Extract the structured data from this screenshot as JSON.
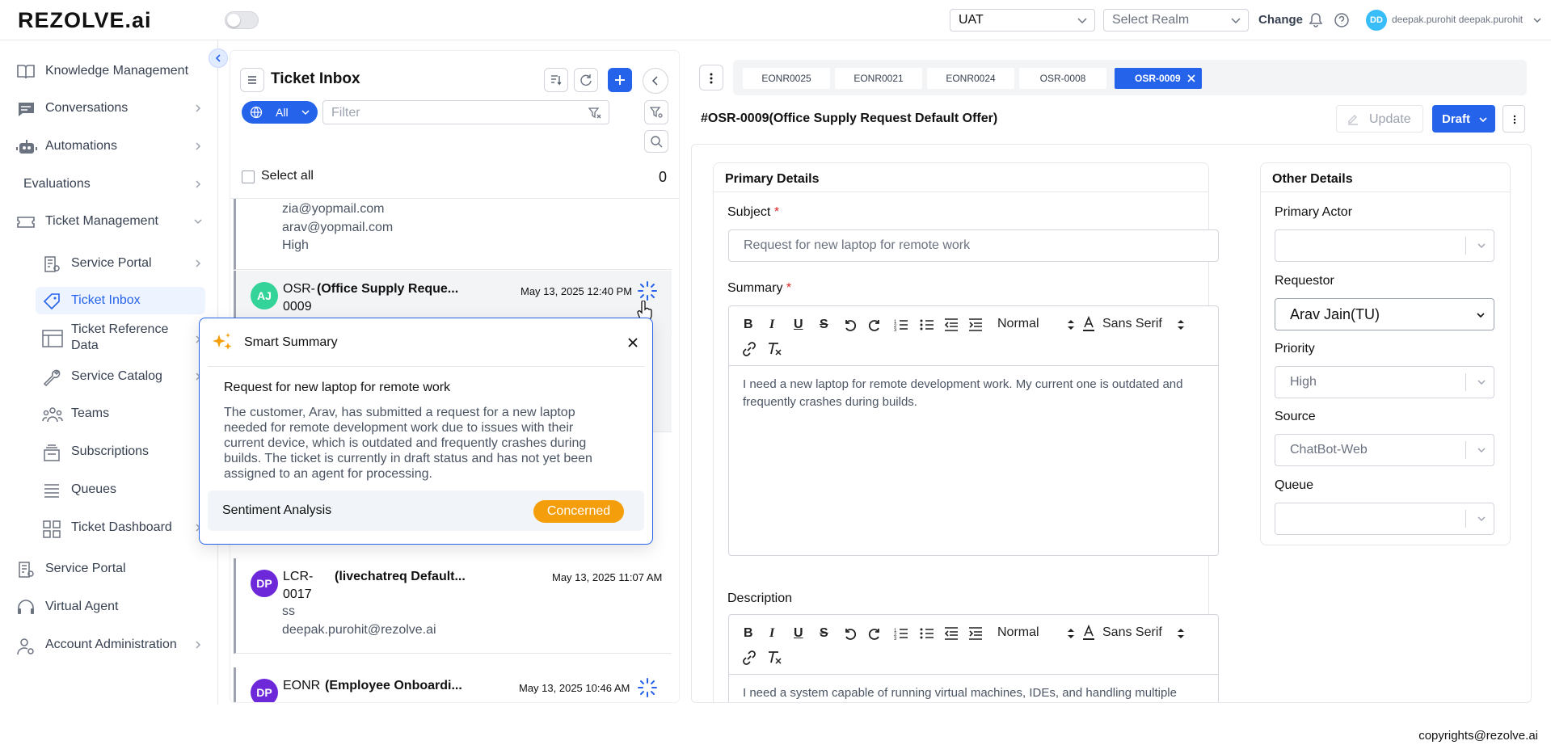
{
  "app": {
    "logo": "REZOLVE.ai"
  },
  "topbar": {
    "env_select": "UAT",
    "realm_placeholder": "Select Realm",
    "change_label": "Change",
    "user_initials": "DD",
    "user_name": "deepak.purohit deepak.purohit"
  },
  "sidebar": {
    "items": [
      {
        "label": "Knowledge Management",
        "icon": "book-icon"
      },
      {
        "label": "Conversations",
        "icon": "chat-icon"
      },
      {
        "label": "Automations",
        "icon": "robot-icon"
      },
      {
        "label": "Evaluations",
        "icon": ""
      },
      {
        "label": "Ticket Management",
        "icon": "ticket-icon"
      },
      {
        "label": "Service Portal",
        "icon": "portal-icon"
      },
      {
        "label": "Ticket Inbox",
        "icon": "tag-icon"
      },
      {
        "label": "Ticket Reference",
        "label2": "Data",
        "icon": "table-icon"
      },
      {
        "label": "Service Catalog",
        "icon": "wrench-icon"
      },
      {
        "label": "Teams",
        "icon": "team-icon"
      },
      {
        "label": "Subscriptions",
        "icon": "layers-icon"
      },
      {
        "label": "Queues",
        "icon": "list-icon"
      },
      {
        "label": "Ticket Dashboard",
        "icon": "grid-icon"
      },
      {
        "label": "Service Portal",
        "icon": "portal-icon"
      },
      {
        "label": "Virtual Agent",
        "icon": "headset-icon"
      },
      {
        "label": "Account Administration",
        "icon": "user-gear-icon"
      }
    ]
  },
  "inbox": {
    "title": "Ticket Inbox",
    "scope_label": "All",
    "filter_placeholder": "Filter",
    "select_all": "Select all",
    "selected_count": "0",
    "partial_card": {
      "line1": "zia@yopmail.com",
      "line2": "arav@yopmail.com",
      "line3": "High"
    },
    "tickets": [
      {
        "initials": "AJ",
        "id1": "OSR-",
        "id2": "0009",
        "title": "(Office Supply Reque...",
        "date": "May 13, 2025 12:40 PM",
        "avatar_color": "#34d399"
      },
      {
        "initials": "DP",
        "id1": "LCR-",
        "id2": "0017",
        "title": "(livechatreq Default...",
        "date": "May 13, 2025 11:07 AM",
        "line1": "ss",
        "line2": "deepak.purohit@rezolve.ai",
        "avatar_color": "#6d28d9"
      },
      {
        "initials": "DP",
        "id1": "EONR",
        "id2": "",
        "title": "(Employee Onboardi...",
        "date": "May 13, 2025 10:46 AM",
        "avatar_color": "#6d28d9"
      }
    ]
  },
  "smart_summary": {
    "title": "Smart Summary",
    "subject": "Request for new laptop for remote work",
    "lines": [
      "The customer, Arav, has submitted a request for a new laptop",
      "needed for remote development work due to issues with their",
      "current device, which is outdated and frequently crashes during",
      "builds. The ticket is currently in draft status and has not yet been",
      "assigned to an agent for processing."
    ],
    "sentiment_label": "Sentiment Analysis",
    "sentiment_value": "Concerned"
  },
  "detail": {
    "tabs": [
      "EONR0025",
      "EONR0021",
      "EONR0024",
      "OSR-0008",
      "OSR-0009"
    ],
    "active_tab": "OSR-0009",
    "header": "#OSR-0009(Office Supply Request Default Offer)",
    "update_label": "Update",
    "draft_label": "Draft",
    "primary": {
      "title": "Primary Details",
      "subject_label": "Subject",
      "subject_value": "Request for new laptop for remote work",
      "summary_label": "Summary",
      "summary_lines": [
        "I need a new laptop for remote development work. My current one is outdated and",
        "frequently crashes during builds."
      ],
      "description_label": "Description",
      "description_line": "I need a system capable of running virtual machines, IDEs, and handling multiple",
      "toolbar": {
        "format": "Normal",
        "font": "Sans Serif"
      }
    },
    "other": {
      "title": "Other Details",
      "primary_actor_label": "Primary Actor",
      "requestor_label": "Requestor",
      "requestor_value": "Arav Jain(TU)",
      "priority_label": "Priority",
      "priority_value": "High",
      "source_label": "Source",
      "source_value": "ChatBot-Web",
      "queue_label": "Queue"
    }
  },
  "footer": {
    "copyright": "copyrights@rezolve.ai"
  },
  "colors": {
    "accent": "#2563eb",
    "concerned": "#f59e0b",
    "required": "#dc2626"
  }
}
